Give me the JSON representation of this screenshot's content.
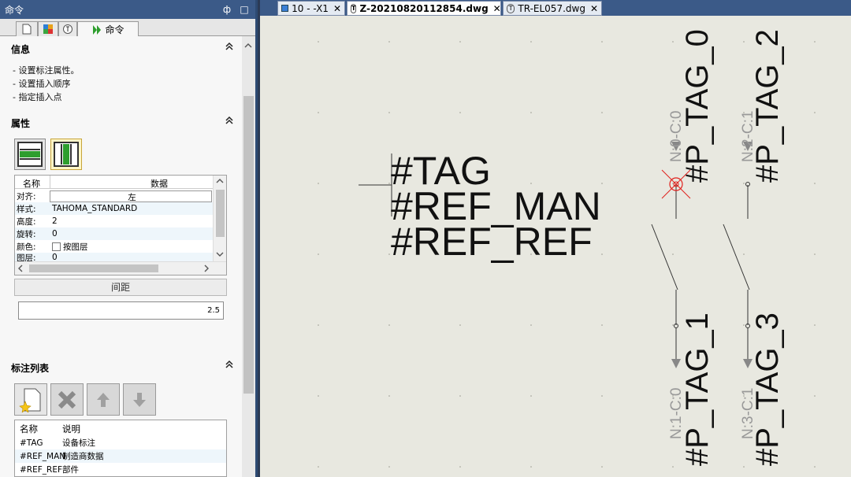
{
  "palette": {
    "title": "命令",
    "pin_glyph": "ф",
    "max_glyph": "□",
    "tabs": [
      {
        "icon": "page-icon"
      },
      {
        "icon": "puzzle-icon"
      },
      {
        "icon": "tag-icon"
      },
      {
        "icon": "play-icon",
        "label": "命令"
      }
    ],
    "info": {
      "title": "信息",
      "lines": [
        "- 设置标注属性。",
        "- 设置插入顺序",
        "- 指定插入点"
      ]
    },
    "properties": {
      "title": "属性",
      "grid": {
        "headers": [
          "名称",
          "数据"
        ],
        "rows": [
          {
            "name": "对齐:",
            "value": "左"
          },
          {
            "name": "样式:",
            "value": "TAHOMA_STANDARD"
          },
          {
            "name": "高度:",
            "value": "2"
          },
          {
            "name": "旋转:",
            "value": "0"
          },
          {
            "name": "颜色:",
            "value": "按图层"
          },
          {
            "name": "图层:",
            "value": "0"
          }
        ]
      },
      "spacing_label": "间距",
      "spacing_value": "2.5"
    },
    "annotation_list": {
      "title": "标注列表",
      "headers": [
        "名称",
        "说明"
      ],
      "rows": [
        {
          "name": "#TAG",
          "desc": "设备标注"
        },
        {
          "name": "#REF_MAN",
          "desc": "制造商数据"
        },
        {
          "name": "#REF_REF",
          "desc": "部件"
        }
      ]
    }
  },
  "doc_tabs": [
    {
      "label": "10 - -X1",
      "active": false
    },
    {
      "label": "Z-20210820112854.dwg",
      "active": true
    },
    {
      "label": "TR-EL057.dwg",
      "active": false
    }
  ],
  "drawing": {
    "tag_lines": [
      "#TAG",
      "#REF_MAN",
      "#REF_REF"
    ],
    "components": [
      {
        "tag": "#P_TAG_0",
        "node": "N:0-C:0"
      },
      {
        "tag": "#P_TAG_2",
        "node": "N:2-C:1"
      },
      {
        "tag": "#P_TAG_1",
        "node": "N:1-C:0"
      },
      {
        "tag": "#P_TAG_3",
        "node": "N:3-C:1"
      }
    ]
  },
  "colors": {
    "title_bar": "#3b5a88",
    "canvas_bg": "#e8e8e0",
    "selection_red": "#e0201c",
    "green_fill": "#2e9e2e"
  }
}
